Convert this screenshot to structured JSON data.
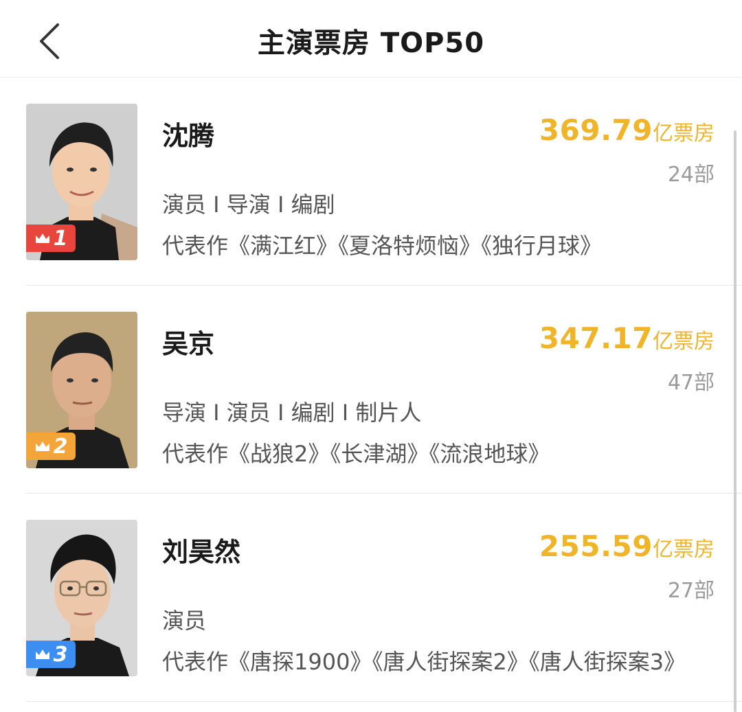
{
  "header": {
    "title": "主演票房 TOP50",
    "back_icon": "chevron-left-icon"
  },
  "colors": {
    "gross": "#f0b428",
    "rank_1": "#e8463c",
    "rank_2": "#f3a53a",
    "rank_3": "#3c8ef0"
  },
  "actors": [
    {
      "rank": "1",
      "name": "沈腾",
      "gross_value": "369.79",
      "gross_unit": "亿票房",
      "count": "24部",
      "roles": "演员 I 导演 I 编剧",
      "works": "代表作《满江红》《夏洛特烦恼》《独行月球》"
    },
    {
      "rank": "2",
      "name": "吴京",
      "gross_value": "347.17",
      "gross_unit": "亿票房",
      "count": "47部",
      "roles": "导演 I 演员 I 编剧 I 制片人",
      "works": "代表作《战狼2》《长津湖》《流浪地球》"
    },
    {
      "rank": "3",
      "name": "刘昊然",
      "gross_value": "255.59",
      "gross_unit": "亿票房",
      "count": "27部",
      "roles": "演员",
      "works": "代表作《唐探1900》《唐人街探案2》《唐人街探案3》"
    }
  ]
}
